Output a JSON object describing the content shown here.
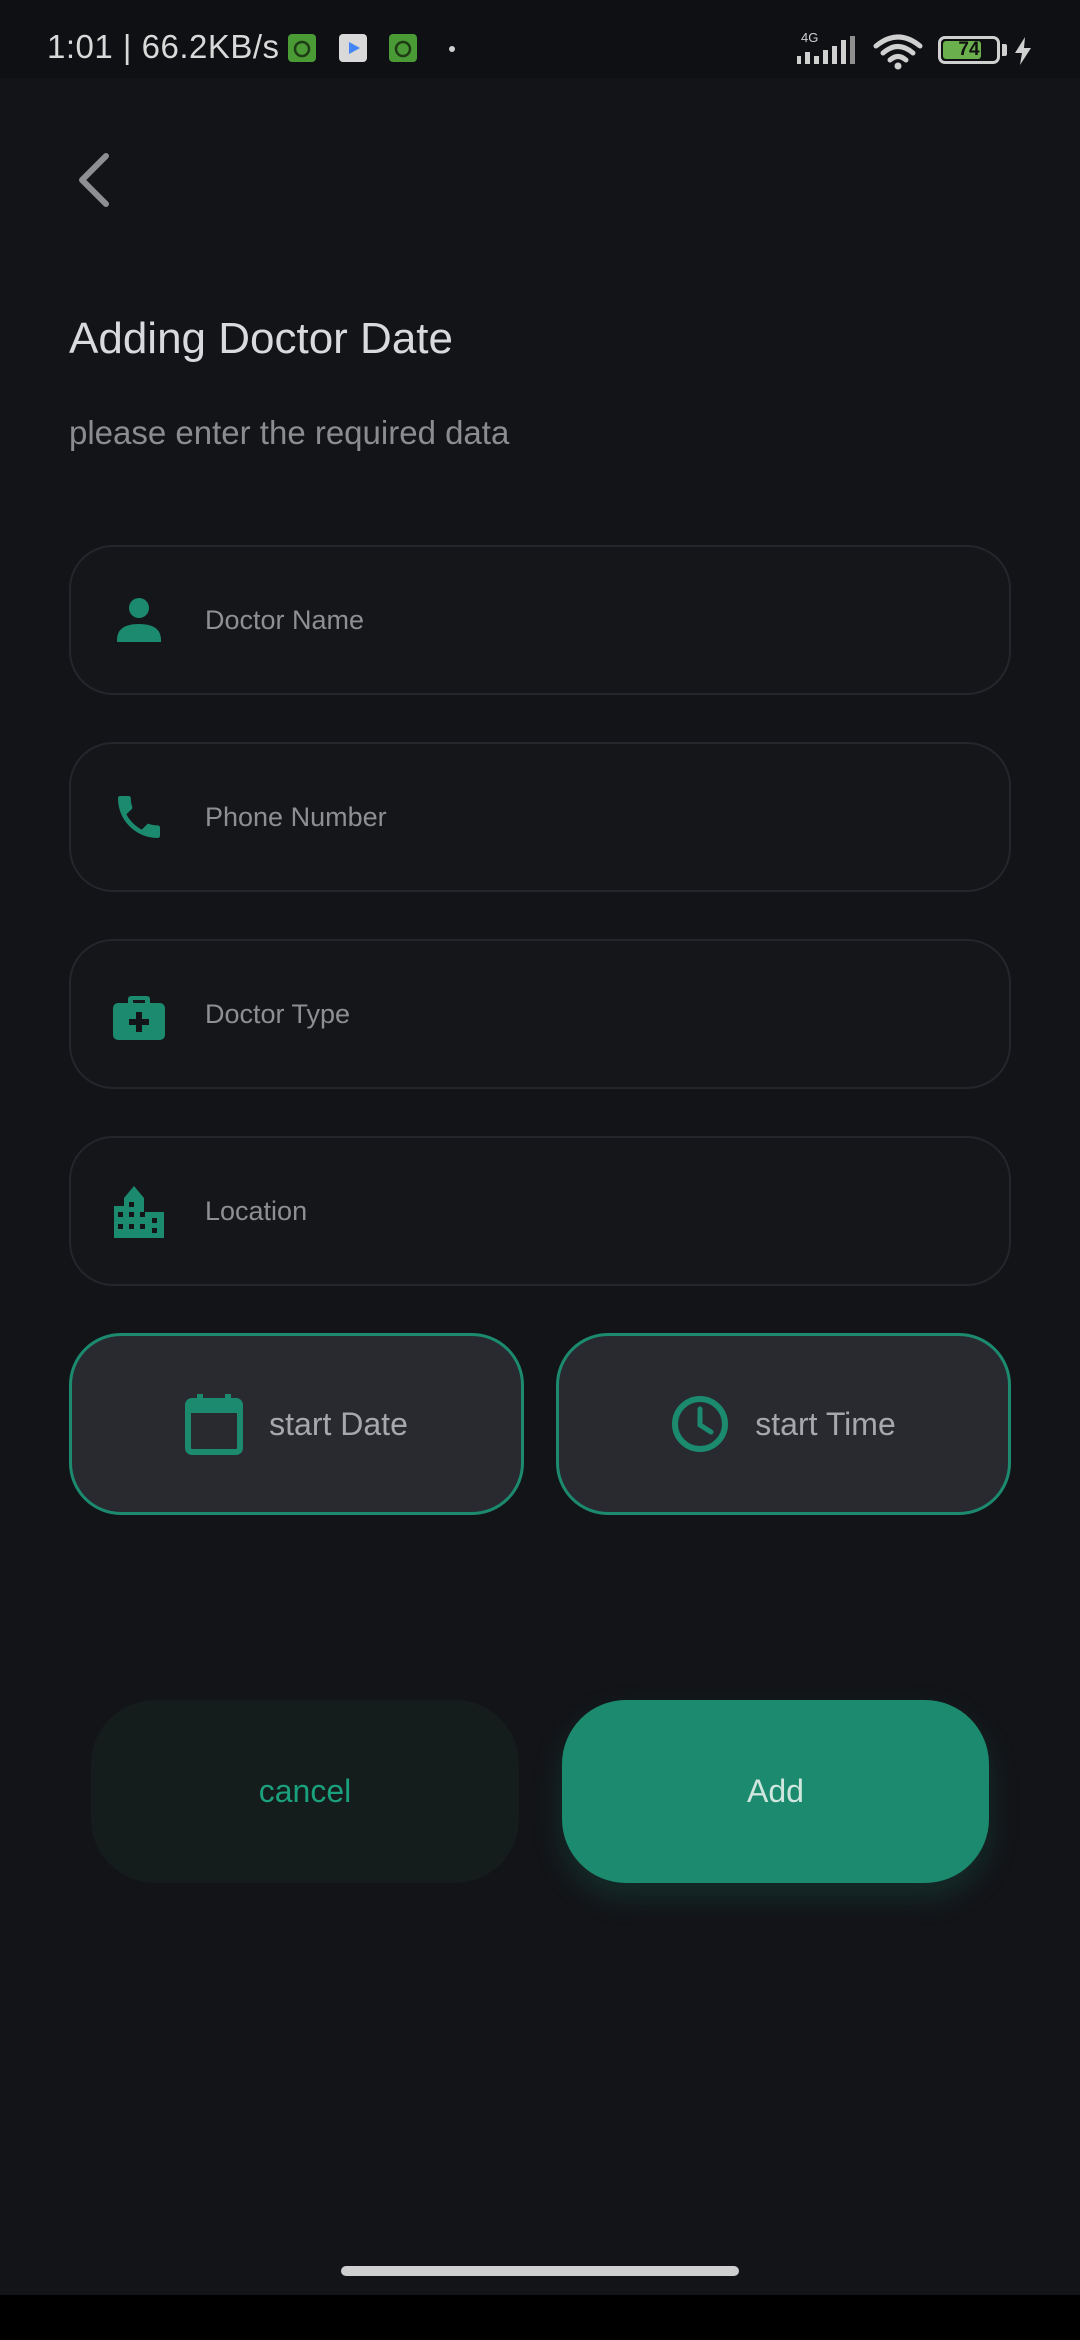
{
  "status_bar": {
    "time_speed": "1:01 | 66.2KB/s",
    "network": "4G",
    "battery_level": "74",
    "battery_fraction": 0.74
  },
  "header": {
    "title": "Adding Doctor Date",
    "subtitle": "please enter the required data"
  },
  "form": {
    "doctor_name_placeholder": "Doctor Name",
    "phone_placeholder": "Phone Number",
    "doctor_type_placeholder": "Doctor Type",
    "location_placeholder": "Location"
  },
  "pickers": {
    "date_label": "start Date",
    "time_label": "start Time"
  },
  "actions": {
    "cancel_label": "cancel",
    "add_label": "Add"
  },
  "icons": {
    "back": "back-arrow-icon",
    "person": "person-icon",
    "phone": "phone-icon",
    "medical_bag": "medical-bag-icon",
    "building": "building-icon",
    "calendar": "calendar-icon",
    "clock": "clock-icon"
  },
  "colors": {
    "accent": "#1b8a6e",
    "background": "#131418",
    "field_border": "#24262b",
    "picker_bg": "#282a30"
  }
}
